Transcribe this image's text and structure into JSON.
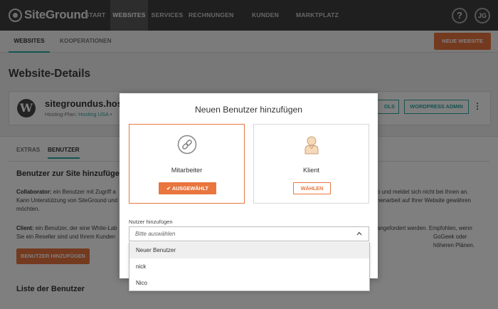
{
  "topnav": {
    "logo_text": "SiteGround",
    "items": [
      "START",
      "WEBSITES",
      "SERVICES",
      "RECHNUNGEN",
      "KUNDEN WERBEN",
      "MARKTPLATZ"
    ],
    "active_index": 1,
    "help_label": "?",
    "avatar_initials": "JG"
  },
  "subnav": {
    "items": [
      "WEBSITES",
      "KOOPERATIONEN"
    ],
    "new_site_button": "NEUE WEBSITE"
  },
  "page": {
    "title": "Website-Details"
  },
  "site": {
    "name": "sitegroundus.hostin",
    "plan_prefix": "Hosting-Plan:",
    "plan_name": "Hosting USA",
    "plan_suffix": "•",
    "tools_button": "OLS",
    "wpadmin_button": "WORDPRESS ADMIN"
  },
  "panel": {
    "tabs": [
      "EXTRAS",
      "BENUTZER"
    ],
    "active_tab": 1,
    "section_title": "Benutzer zur Site hinzufügen",
    "collaborator": {
      "term": "Collaborator:",
      "line1": "ein Benutzer mit Zugriff a",
      "line1_end": "o und meldet sich nicht bei Ihnen an.",
      "line2": "Kann Unterstützung von SiteGround und",
      "line2_end": "nenarbeit auf Ihrer Website gewähren",
      "line3": "möchten."
    },
    "client": {
      "term": "Client:",
      "line1": "ein Benutzer, der eine White-Lab",
      "line1_end": "angefordert werden. Empfohlen, wenn",
      "line2": "Sie ein Reseller sind und Ihrem Kunden",
      "line2_end": "GoGeek oder höheren Plänen."
    },
    "add_user_button": "BENUTZER HINZUFÜGEN",
    "list_title": "Liste der Benutzer"
  },
  "modal": {
    "title": "Neuen Benutzer hinzufügen",
    "roles": [
      {
        "label": "Mitarbeiter",
        "button": "AUSGEWÄHLT",
        "selected": true,
        "icon": "link-icon"
      },
      {
        "label": "Klient",
        "button": "WÄHLEN",
        "selected": false,
        "icon": "person-icon"
      }
    ],
    "field_label": "Nutzer hinzufügen",
    "select_placeholder": "Bitte auswählen",
    "options": [
      "Neuer Benutzer",
      "nick",
      "Nico"
    ],
    "hovered_option": 0
  },
  "colors": {
    "accent": "#e9753f",
    "teal": "#2ba8a2",
    "nav_bg": "#3e3e3e"
  }
}
